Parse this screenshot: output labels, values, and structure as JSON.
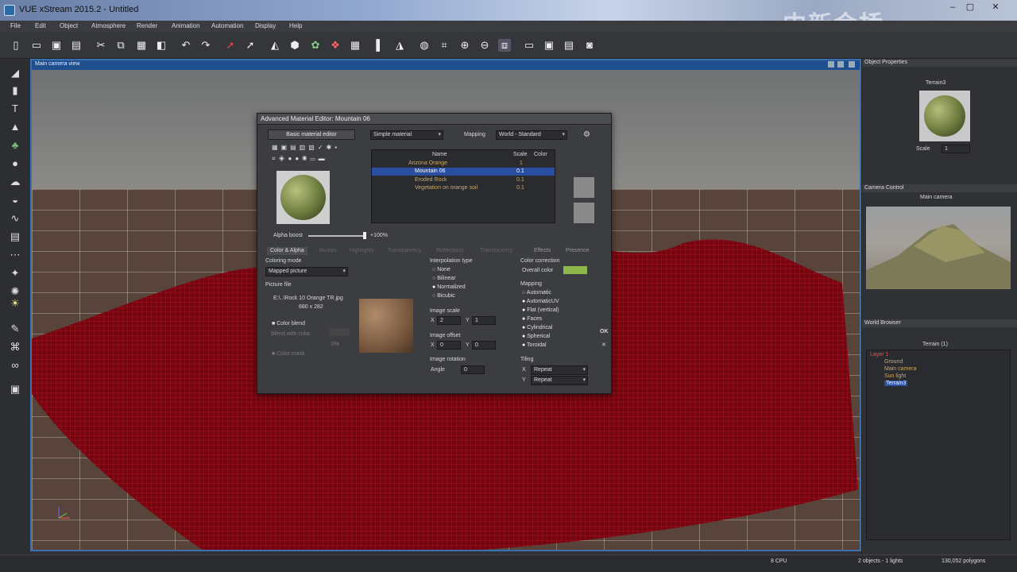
{
  "window": {
    "title": "VUE xStream 2015.2 - Untitled",
    "watermark": "中新金桥"
  },
  "menu": [
    "File",
    "Edit",
    "Object",
    "Atmosphere",
    "Render",
    "Animation",
    "Automation",
    "Display",
    "Help"
  ],
  "viewport": {
    "label": "Main camera view"
  },
  "material_editor": {
    "title": "Advanced Material Editor: Mountain 06",
    "basic_button": "Basic material editor",
    "material_type": "Simple material",
    "mapping_label": "Mapping",
    "mapping_value": "World - Standard",
    "columns": [
      "Name",
      "Scale",
      "Color"
    ],
    "layers": [
      {
        "name": "Arizona Orange",
        "scale": "1"
      },
      {
        "name": "Mountain 06",
        "scale": "0.1"
      },
      {
        "name": "Eroded Rock",
        "scale": "0.1"
      },
      {
        "name": "Vegetation on orange soil",
        "scale": "0.1"
      }
    ],
    "alpha_boost_label": "Alpha boost",
    "alpha_boost_value": "+100%",
    "tabs": [
      "Color & Alpha",
      "Bumps",
      "Highlights",
      "Transparency",
      "Reflections",
      "Translucency",
      "Effects",
      "Presence"
    ],
    "coloring_mode_label": "Coloring mode",
    "coloring_mode_value": "Mapped picture",
    "picture_file_label": "Picture file",
    "picture_file": "E:\\..\\Rock 10 Orange TR.jpg",
    "picture_size": "680 x 282",
    "color_blend": "Color blend",
    "blend_with_color": "Blend with color",
    "blend_percent": "0%",
    "color_mask": "Color mask",
    "interpolation_label": "Interpolation type",
    "interpolation": [
      "None",
      "Bilinear",
      "Normalized",
      "Bicubic"
    ],
    "image_scale_label": "Image scale",
    "scale_x": "2",
    "scale_y": "1",
    "image_offset_label": "Image offset",
    "offset_x": "0",
    "offset_y": "0",
    "image_rotation_label": "Image rotation",
    "angle_label": "Angle",
    "angle_value": "0",
    "color_correction_label": "Color correction",
    "overall_color_label": "Overall color",
    "overall_color": "#8fb64a",
    "mapping_section_label": "Mapping",
    "mapping_options": [
      "Automatic",
      "AutomaticUV",
      "Flat (vertical)",
      "Faces",
      "Cylindrical",
      "Spherical",
      "Toroidal"
    ],
    "tiling_label": "Tiling",
    "tiling_x": "Repeat",
    "tiling_y": "Repeat",
    "ok": "OK"
  },
  "object_properties": {
    "header": "Object Properties",
    "name": "Terrain3",
    "scale_label": "Scale",
    "scale_value": "1"
  },
  "camera_control": {
    "header": "Camera Control",
    "camera": "Main camera"
  },
  "world_browser": {
    "header": "World Browser",
    "title": "Terrain (1)",
    "items": [
      "Layer 1",
      "Ground",
      "Main camera",
      "Sun light",
      "Terrain3"
    ]
  },
  "status": {
    "cpu": "8 CPU",
    "objects": "2 objects - 1 lights",
    "polygons": "130,052 polygons"
  }
}
